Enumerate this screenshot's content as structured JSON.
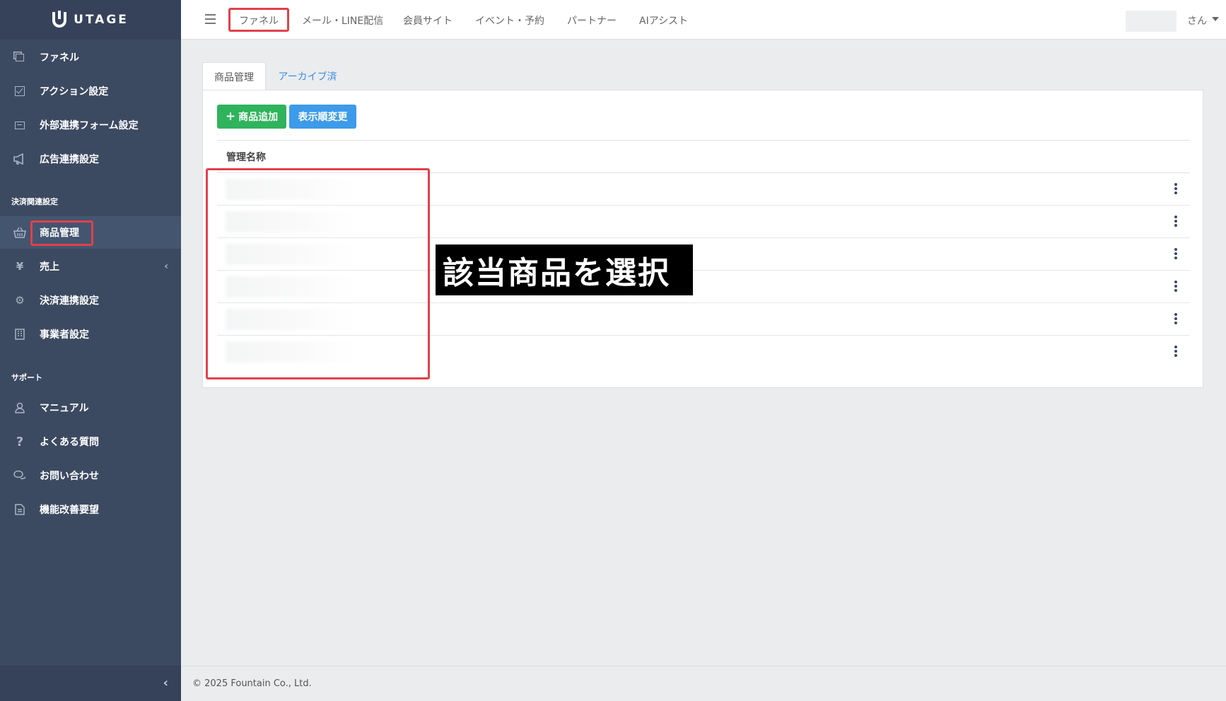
{
  "brand": {
    "name": "UTAGE"
  },
  "sidebar": {
    "items_top": [
      {
        "label": "ファネル",
        "icon": "copy-icon"
      },
      {
        "label": "アクション設定",
        "icon": "checkbox-icon"
      },
      {
        "label": "外部連携フォーム設定",
        "icon": "form-icon"
      },
      {
        "label": "広告連携設定",
        "icon": "megaphone-icon"
      }
    ],
    "section_payment": "決済関連設定",
    "items_payment": [
      {
        "label": "商品管理",
        "icon": "basket-icon",
        "active": true
      },
      {
        "label": "売上",
        "icon": "yen-icon",
        "caret": "‹"
      },
      {
        "label": "決済連携設定",
        "icon": "gear-icon"
      },
      {
        "label": "事業者設定",
        "icon": "building-icon"
      }
    ],
    "section_support": "サポート",
    "items_support": [
      {
        "label": "マニュアル",
        "icon": "user-icon"
      },
      {
        "label": "よくある質問",
        "icon": "question-icon"
      },
      {
        "label": "お問い合わせ",
        "icon": "chat-icon"
      },
      {
        "label": "機能改善要望",
        "icon": "document-icon"
      }
    ],
    "collapse_icon": "chevron-left-icon"
  },
  "header": {
    "nav": [
      "ファネル",
      "メール・LINE配信",
      "会員サイト",
      "イベント・予約",
      "パートナー",
      "AIアシスト"
    ],
    "user_suffix": "さん"
  },
  "tabs": {
    "active": "商品管理",
    "archive": "アーカイブ済"
  },
  "toolbar": {
    "add_label": "商品追加",
    "reorder_label": "表示順変更"
  },
  "table": {
    "header": "管理名称",
    "row_count": 6
  },
  "annotation": {
    "text": "該当商品を選択"
  },
  "footer": {
    "copyright": "© 2025 Fountain Co., Ltd."
  },
  "colors": {
    "sidebar": "#3c4a61",
    "highlight": "#e0414a",
    "green": "#2fb35c",
    "blue": "#3d9be9"
  }
}
